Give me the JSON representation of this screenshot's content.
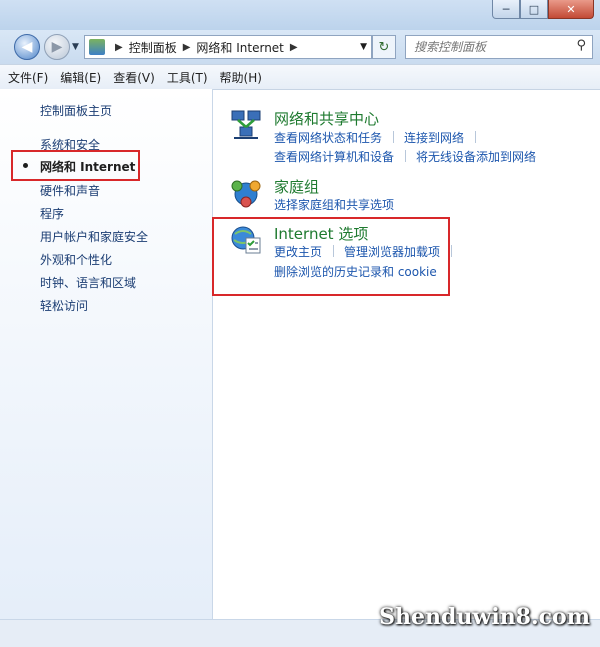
{
  "window": {
    "minimize_glyph": "─",
    "maximize_glyph": "□",
    "close_glyph": "✕"
  },
  "nav": {
    "back_glyph": "◀",
    "forward_glyph": "▶",
    "dropdown_glyph": "▼",
    "breadcrumb": [
      "控制面板",
      "网络和 Internet"
    ],
    "refresh_glyph": "↻",
    "search_placeholder": "搜索控制面板",
    "search_glyph": "⚲"
  },
  "menu": [
    "文件(F)",
    "编辑(E)",
    "查看(V)",
    "工具(T)",
    "帮助(H)"
  ],
  "sidebar": {
    "home": "控制面板主页",
    "items": [
      "系统和安全",
      "网络和 Internet",
      "硬件和声音",
      "程序",
      "用户帐户和家庭安全",
      "外观和个性化",
      "时钟、语言和区域",
      "轻松访问"
    ],
    "current_index": 1
  },
  "sections": [
    {
      "title": "网络和共享中心",
      "icon": "network-sharing-icon",
      "links_row1": [
        "查看网络状态和任务",
        "连接到网络"
      ],
      "links_row2": [
        "查看网络计算机和设备",
        "将无线设备添加到网络"
      ]
    },
    {
      "title": "家庭组",
      "icon": "homegroup-icon",
      "links_row1": [
        "选择家庭组和共享选项"
      ]
    },
    {
      "title": "Internet 选项",
      "icon": "internet-options-icon",
      "links_row1": [
        "更改主页",
        "管理浏览器加载项"
      ],
      "links_row2": [
        "删除浏览的历史记录和 cookie"
      ]
    }
  ],
  "watermark": "Shenduwin8.com",
  "colors": {
    "highlight_box": "#d8282a",
    "link": "#1c56ad",
    "section_title": "#1e7a2f"
  }
}
